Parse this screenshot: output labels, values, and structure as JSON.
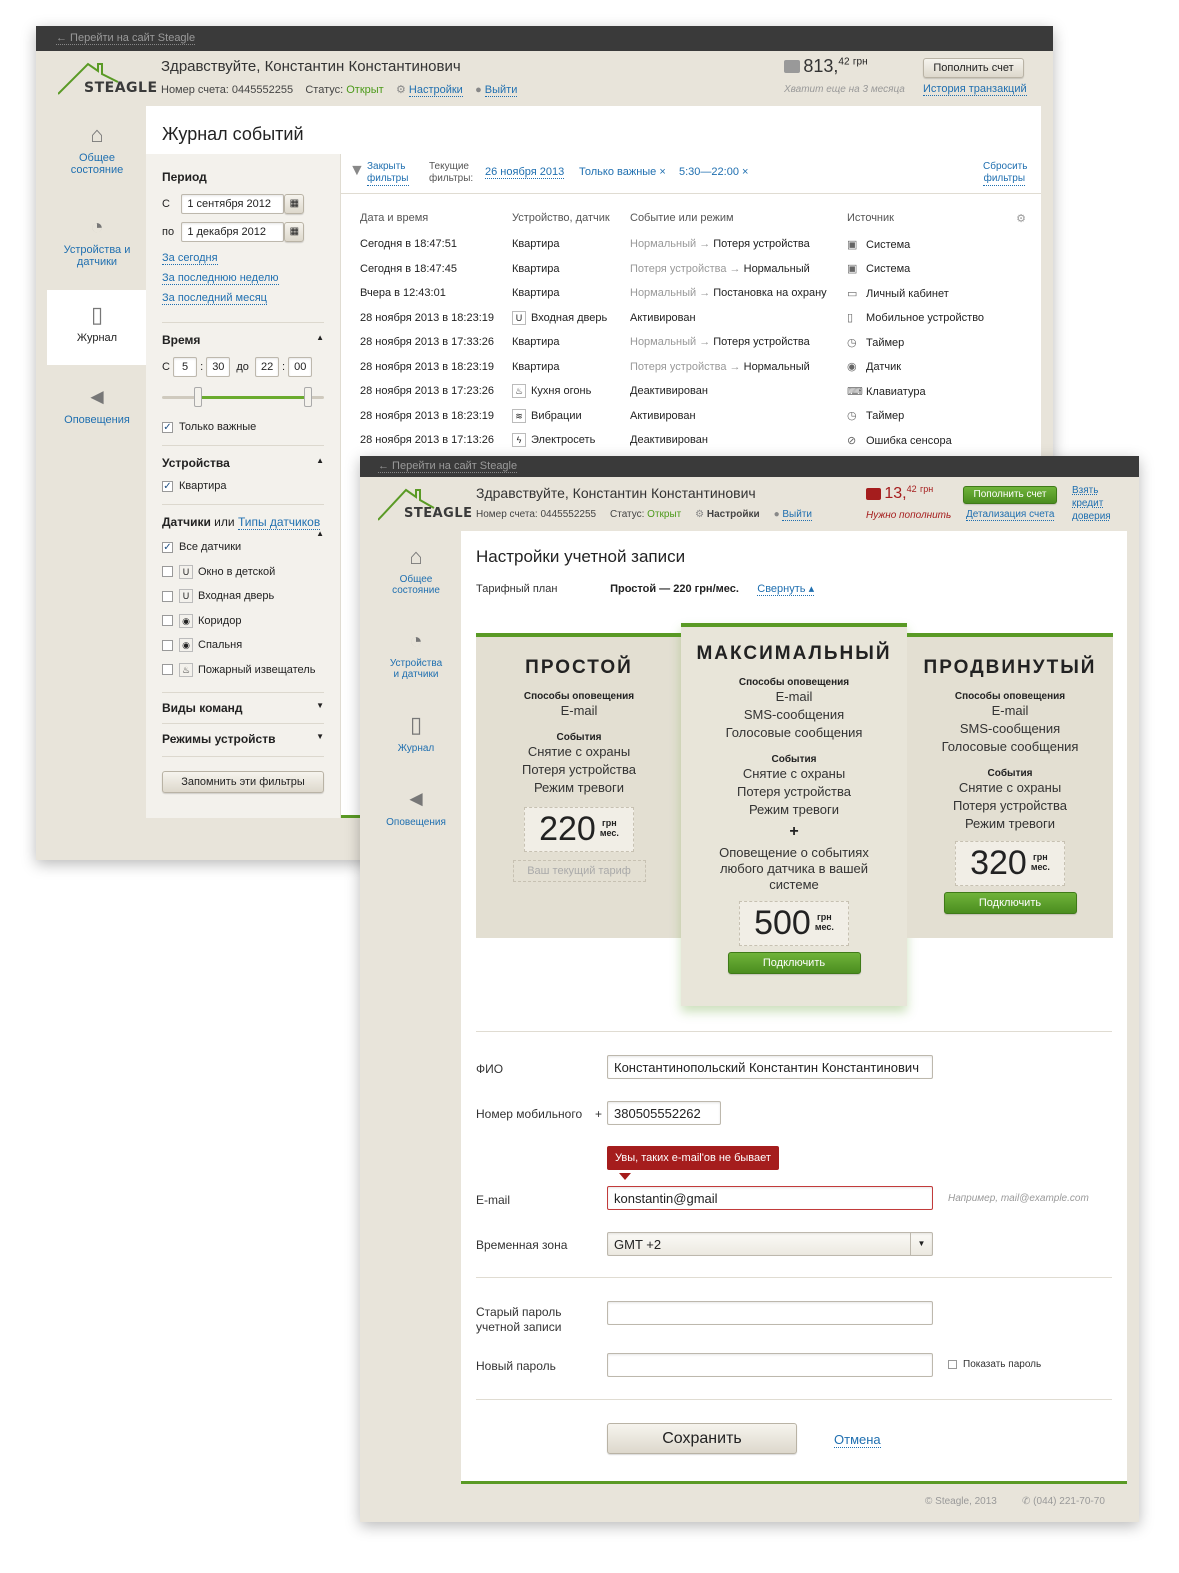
{
  "back": {
    "link": "← Перейти на сайт Steagle"
  },
  "brand": {
    "logo": "STEAGLE"
  },
  "journal": {
    "greeting": "Здравствуйте, Константин Константинович",
    "account": "Номер счета: 0445552255",
    "status_label": "Статус:",
    "status_value": "Открыт",
    "settings": "Настройки",
    "logout": "Выйти",
    "balance_main": "813,",
    "balance_frac": "42",
    "balance_cur": "грн",
    "balance_note": "Хватит еще на 3 месяца",
    "topup": "Пополнить счет",
    "history": "История транзакций",
    "nav": [
      "Общее состояние",
      "Устройства и датчики",
      "Журнал",
      "Оповещения"
    ],
    "title": "Журнал событий",
    "filters": {
      "period_title": "Период",
      "from_label": "С",
      "from_value": "1 сентября 2012",
      "to_label": "по",
      "to_value": "1 декабря 2012",
      "quick": [
        "За сегодня",
        "За последнюю неделю",
        "За последний месяц"
      ],
      "time_title": "Время",
      "time_from_label": "С",
      "h1": "5",
      "m1": "30",
      "time_to_label": "до",
      "h2": "22",
      "m2": "00",
      "important": "Только важные",
      "devices_title": "Устройства",
      "device": "Квартира",
      "sensors_title": "Датчики",
      "sensors_or": "или",
      "sensor_types": "Типы датчиков",
      "sensors": [
        "Все датчики",
        "Окно в детской",
        "Входная дверь",
        "Коридор",
        "Спальня",
        "Пожарный извещатель"
      ],
      "commands": "Виды команд",
      "modes": "Режимы устройств",
      "save": "Запомнить эти фильтры"
    },
    "filterbar": {
      "close": "Закрыть фильтры",
      "current": "Текущие фильтры:",
      "chips": [
        "26 ноября 2013",
        "Только важные ×",
        "5:30—22:00 ×"
      ],
      "reset": "Сбросить фильтры"
    },
    "columns": [
      "Дата и время",
      "Устройство, датчик",
      "Событие или режим",
      "Источник"
    ],
    "rows": [
      {
        "date": "Сегодня в 18:47:51",
        "device": "Квартира",
        "from": "Нормальный →",
        "to": "Потеря устройства",
        "source": "Система"
      },
      {
        "date": "Сегодня в 18:47:45",
        "device": "Квартира",
        "from": "Потеря устройства →",
        "to": "Нормальный",
        "source": "Система"
      },
      {
        "date": "Вчера в 12:43:01",
        "device": "Квартира",
        "from": "Нормальный →",
        "to": "Постановка на охрану",
        "source": "Личный кабинет"
      },
      {
        "date": "28 ноября 2013 в 18:23:19",
        "device": "Входная дверь",
        "from": "",
        "to": "Активирован",
        "source": "Мобильное устройство"
      },
      {
        "date": "28 ноября 2013 в 17:33:26",
        "device": "Квартира",
        "from": "Нормальный →",
        "to": "Потеря устройства",
        "source": "Таймер"
      },
      {
        "date": "28 ноября 2013 в 18:23:19",
        "device": "Квартира",
        "from": "Потеря устройства →",
        "to": "Нормальный",
        "source": "Датчик"
      },
      {
        "date": "28 ноября 2013 в 17:23:26",
        "device": "Кухня огонь",
        "from": "",
        "to": "Деактивирован",
        "source": "Клавиатура"
      },
      {
        "date": "28 ноября 2013 в 18:23:19",
        "device": "Вибрации",
        "from": "",
        "to": "Активирован",
        "source": "Таймер"
      },
      {
        "date": "28 ноября 2013 в 17:13:26",
        "device": "Электросеть",
        "from": "",
        "to": "Деактивирован",
        "source": "Ошибка сенсора"
      }
    ]
  },
  "settings": {
    "greeting": "Здравствуйте, Константин Константинович",
    "account": "Номер счета: 0445552255",
    "status_label": "Статус:",
    "status_value": "Открыт",
    "settings": "Настройки",
    "logout": "Выйти",
    "balance_main": "13,",
    "balance_frac": "42",
    "balance_cur": "грн",
    "balance_note": "Нужно пополнить",
    "topup": "Пополнить счет",
    "details": "Детализация счета",
    "credit": "Взять кредит доверия",
    "nav": [
      "Общее состояние",
      "Устройства и датчики",
      "Журнал",
      "Оповещения"
    ],
    "title": "Настройки учетной записи",
    "tariff_label": "Тарифный план",
    "tariff_value": "Простой — 220 грн/мес.",
    "collapse": "Свернуть ▴",
    "plans": {
      "notify_label": "Способы оповещения",
      "events_label": "События",
      "simple": {
        "name": "ПРОСТОЙ",
        "notify": [
          "E-mail"
        ],
        "events": [
          "Снятие с охраны",
          "Потеря устройства",
          "Режим тревоги"
        ],
        "price": "220",
        "current": "Ваш текущий тариф"
      },
      "max": {
        "name": "МАКСИМАЛЬНЫЙ",
        "notify": [
          "E-mail",
          "SMS-сообщения",
          "Голосовые сообщения"
        ],
        "events": [
          "Снятие с охраны",
          "Потеря устройства",
          "Режим тревоги"
        ],
        "plus": "+",
        "extra": "Оповещение о событиях любого датчика в вашей системе",
        "price": "500",
        "connect": "Подключить"
      },
      "adv": {
        "name": "ПРОДВИНУТЫЙ",
        "notify": [
          "E-mail",
          "SMS-сообщения",
          "Голосовые сообщения"
        ],
        "events": [
          "Снятие с охраны",
          "Потеря устройства",
          "Режим тревоги"
        ],
        "price": "320",
        "connect": "Подключить"
      },
      "per_1": "грн",
      "per_2": "мес."
    },
    "form": {
      "fio_label": "ФИО",
      "fio_value": "Константинопольский Константин Константинович",
      "phone_label": "Номер мобильного",
      "phone_plus": "+",
      "phone_value": "380505552262",
      "error": "Увы, таких e-mail'ов не бывает",
      "email_label": "E-mail",
      "email_value": "konstantin@gmail",
      "email_hint": "Например, mail@example.com",
      "tz_label": "Временная зона",
      "tz_value": "GMT +2",
      "oldpw_label": "Старый пароль учетной записи",
      "newpw_label": "Новый пароль",
      "show_pw": "Показать пароль",
      "save": "Сохранить",
      "cancel": "Отмена"
    },
    "footer_copy": "© Steagle, 2013",
    "footer_phone": "(044) 221-70-70"
  },
  "colors": {
    "accent": "#5a9a25",
    "link": "#1f6fb0",
    "error": "#a51d1d"
  }
}
